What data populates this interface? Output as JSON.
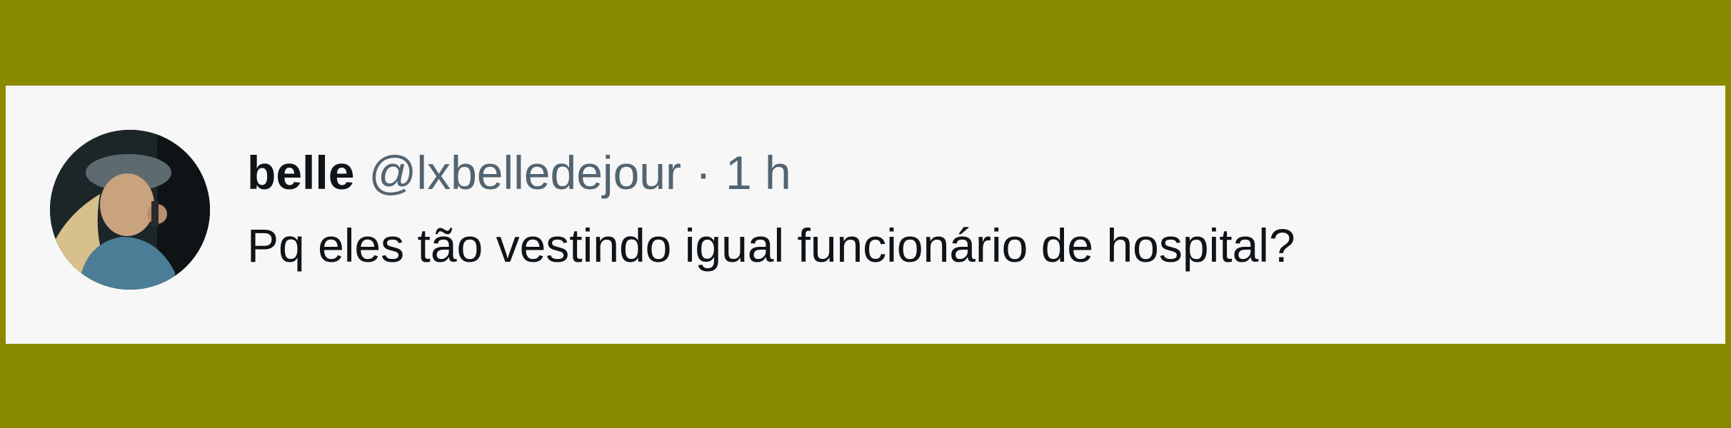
{
  "tweet": {
    "display_name": "belle",
    "handle": "@lxbelledejour",
    "separator": "·",
    "time": "1 h",
    "text": "Pq eles tão vestindo igual funcionário de hospital?"
  },
  "colors": {
    "frame_background": "#8a8a00",
    "card_background": "#f7f7f7",
    "primary_text": "#0f1419",
    "secondary_text": "#536471"
  }
}
